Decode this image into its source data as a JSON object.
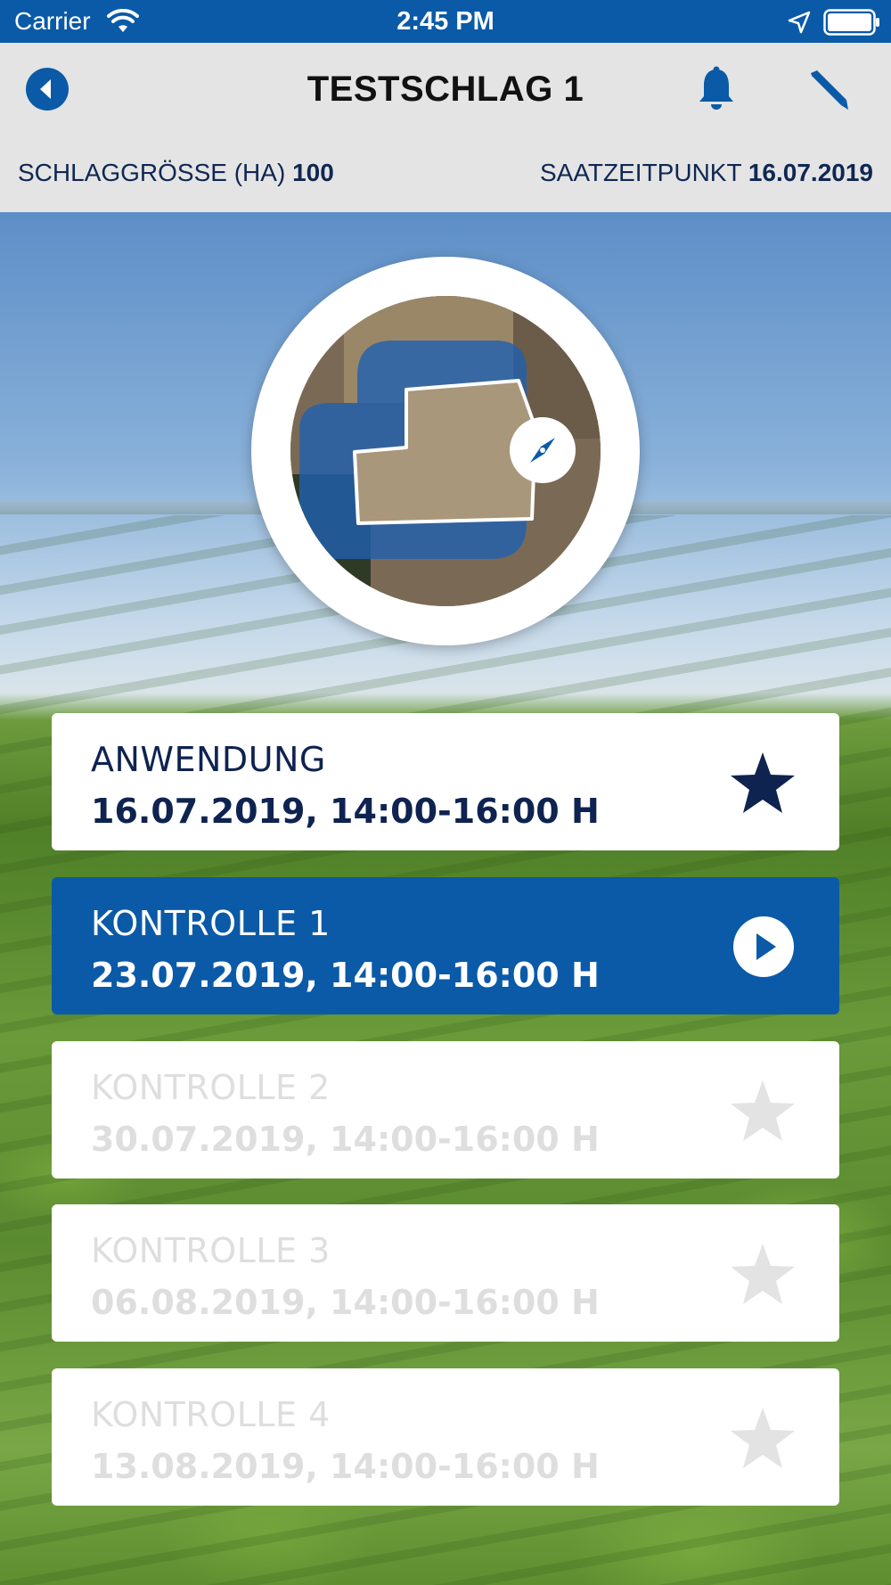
{
  "status_bar": {
    "carrier": "Carrier",
    "time": "2:45 PM",
    "icons": [
      "wifi-icon",
      "location-arrow-icon",
      "battery-icon"
    ]
  },
  "nav": {
    "title": "TESTSCHLAG 1",
    "icons": [
      "back-arrow-icon",
      "bell-icon",
      "pencil-icon"
    ]
  },
  "info": {
    "size_label": "SCHLAGGRÖSSE (HA)",
    "size_value": "100",
    "sowing_label": "SAATZEITPUNKT",
    "sowing_value": "16.07.2019"
  },
  "map": {
    "compass_icon": "compass-icon"
  },
  "sessions": [
    {
      "title": "ANWENDUNG",
      "date": "16.07.2019, 14:00-16:00 H",
      "state": "completed",
      "icon": "star-icon"
    },
    {
      "title": "KONTROLLE 1",
      "date": "23.07.2019, 14:00-16:00 H",
      "state": "active",
      "icon": "play-icon"
    },
    {
      "title": "KONTROLLE 2",
      "date": "30.07.2019, 14:00-16:00 H",
      "state": "disabled",
      "icon": "star-icon"
    },
    {
      "title": "KONTROLLE 3",
      "date": "06.08.2019, 14:00-16:00 H",
      "state": "disabled",
      "icon": "star-icon"
    },
    {
      "title": "KONTROLLE 4",
      "date": "13.08.2019, 14:00-16:00 H",
      "state": "disabled",
      "icon": "star-icon"
    }
  ],
  "colors": {
    "brand_blue": "#0a5aa8",
    "navy": "#0e2350",
    "disabled_text": "#dedede",
    "nav_background": "#e4e4e4"
  }
}
